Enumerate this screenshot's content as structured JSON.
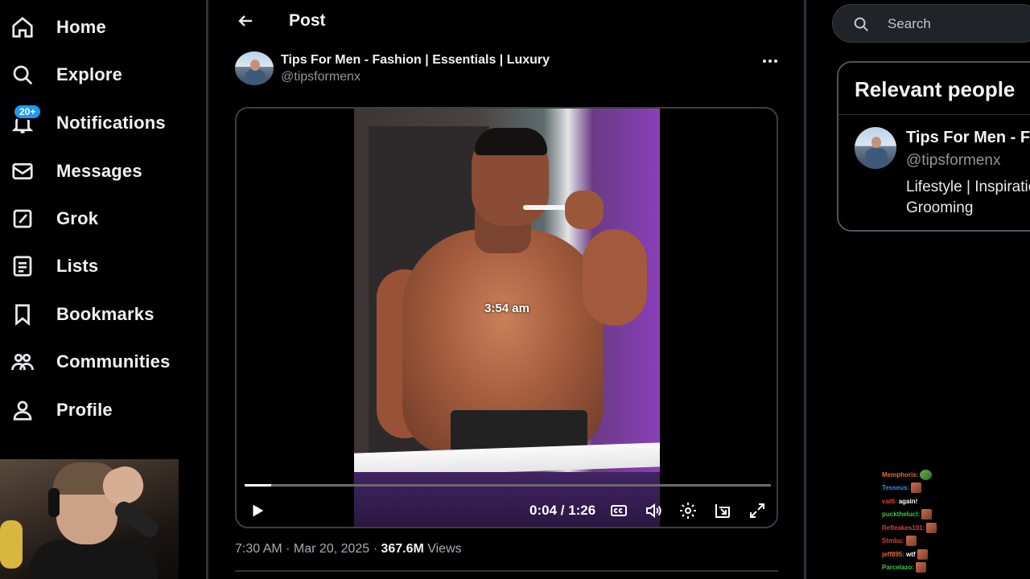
{
  "nav": {
    "items": [
      {
        "label": "Home",
        "icon": "home-icon"
      },
      {
        "label": "Explore",
        "icon": "search-icon"
      },
      {
        "label": "Notifications",
        "icon": "bell-icon",
        "badge": "20+"
      },
      {
        "label": "Messages",
        "icon": "mail-icon"
      },
      {
        "label": "Grok",
        "icon": "grok-icon"
      },
      {
        "label": "Lists",
        "icon": "list-icon"
      },
      {
        "label": "Bookmarks",
        "icon": "bookmark-icon"
      },
      {
        "label": "Communities",
        "icon": "communities-icon"
      },
      {
        "label": "Profile",
        "icon": "person-icon"
      }
    ]
  },
  "header": {
    "title": "Post"
  },
  "post": {
    "author_name": "Tips For Men - Fashion | Essentials | Luxury",
    "author_handle": "@tipsformenx",
    "video": {
      "overlay_text": "3:54 am",
      "time_readout": "0:04 / 1:26",
      "progress_fraction": 0.05
    },
    "timestamp": "7:30 AM · Mar 20, 2025 · ",
    "views_count": "367.6M",
    "views_label": " Views"
  },
  "search": {
    "placeholder": "Search"
  },
  "relevant": {
    "heading": "Relevant people",
    "name": "Tips For Men - Fashion | Essentials | Luxury",
    "handle": "@tipsformenx",
    "bio": "Lifestyle | Inspiration | Grooming"
  },
  "chat": [
    {
      "user": "Memphoris",
      "color": "#e06c3c",
      "msg": "",
      "emote": "frog"
    },
    {
      "user": "Tesseus",
      "color": "#3c8ce0",
      "msg": "",
      "emote": "face"
    },
    {
      "user": "vat6",
      "color": "#e03c3c",
      "msg": " again!",
      "emote": ""
    },
    {
      "user": "puckthelucl",
      "color": "#3cc93c",
      "msg": "",
      "emote": "face"
    },
    {
      "user": "Refleakes101",
      "color": "#e03c3c",
      "msg": "",
      "emote": "face"
    },
    {
      "user": "Stmbu",
      "color": "#e03c3c",
      "msg": "",
      "emote": "face"
    },
    {
      "user": "jeff895",
      "color": "#e06c3c",
      "msg": " wtf",
      "emote": "face"
    },
    {
      "user": "Parcelazo",
      "color": "#3cc93c",
      "msg": "",
      "emote": "face"
    }
  ]
}
